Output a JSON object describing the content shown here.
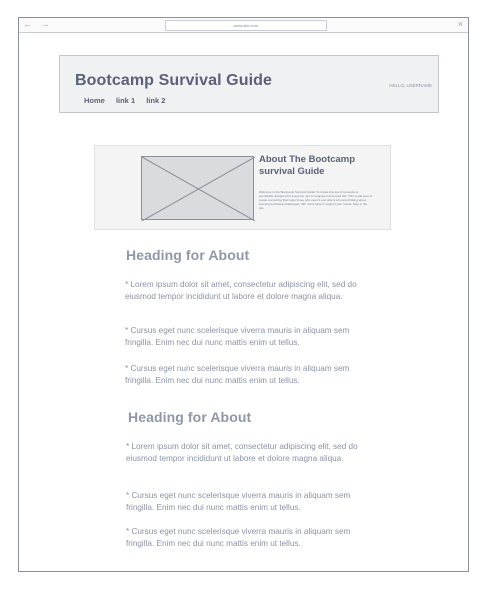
{
  "browser": {
    "url": "www.site.com",
    "back_forward": "← →",
    "reload_icon": "↻",
    "close_icon": "×"
  },
  "header": {
    "title": "Bootcamp Survival Guide",
    "links": [
      "Home",
      "link 1",
      "link 2"
    ],
    "greeting": "HELLO, USERNAME"
  },
  "about": {
    "title": "About The Bootcamp survival Guide",
    "text": "Welcome to the Bootcamp Survival Guide! To create this set of concepts to specifically designed for everyone new to engineers and need this. This made sure to create something that helps those who need it and others who are thinking about learning and being challenged, with many tools to support your needs. Stay in the site."
  },
  "sections": [
    {
      "heading": "Heading for About",
      "paragraphs": [
        "* Lorem ipsum dolor sit amet, consectetur adipiscing elit, sed do eiusmod tempor incididunt ut labore et dolore magna aliqua.",
        "* Cursus eget nunc scelerisque viverra mauris in aliquam sem fringilla. Enim nec dui nunc mattis enim ut tellus.",
        "* Cursus eget nunc scelerisque viverra mauris in aliquam sem fringilla. Enim nec dui nunc mattis enim ut tellus."
      ]
    },
    {
      "heading": "Heading for About",
      "paragraphs": [
        "* Lorem ipsum dolor sit amet, consectetur adipiscing elit, sed do eiusmod tempor incididunt ut labore et dolore magna aliqua.",
        "* Cursus eget nunc scelerisque viverra mauris in aliquam sem fringilla. Enim nec dui nunc mattis enim ut tellus.",
        "* Cursus eget nunc scelerisque viverra mauris in aliquam sem fringilla. Enim nec dui nunc mattis enim ut tellus."
      ]
    }
  ]
}
